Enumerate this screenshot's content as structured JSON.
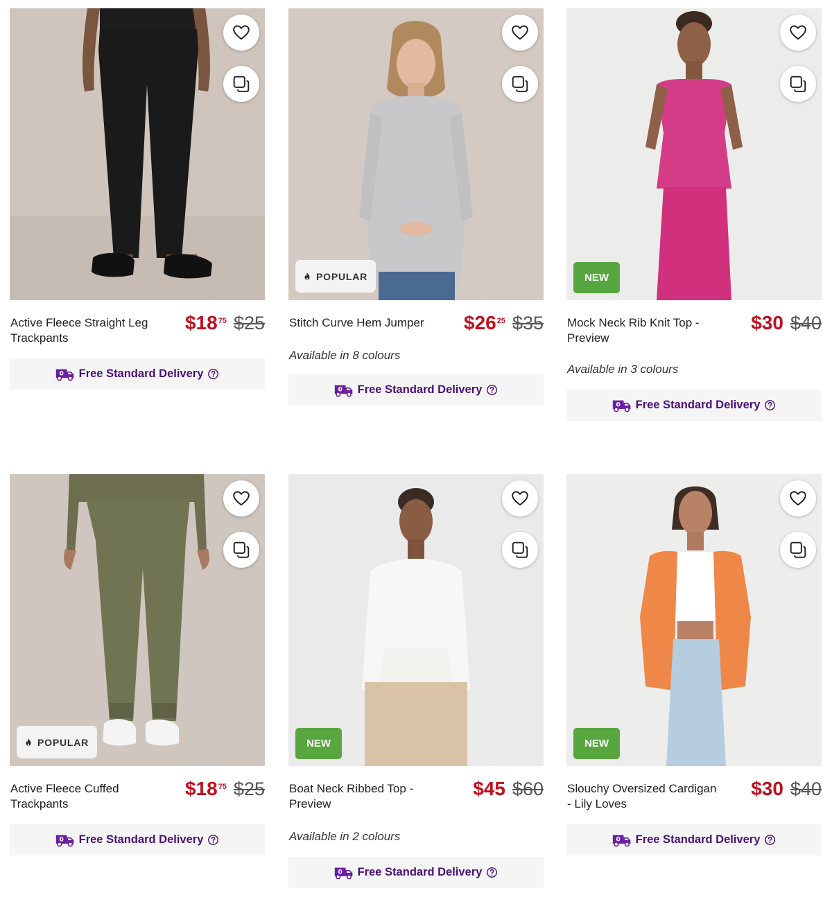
{
  "colors": {
    "accent_price": "#c0101f",
    "delivery_text": "#4b0f78",
    "new_badge": "#57a63f"
  },
  "icons": {
    "favourite": "heart-icon",
    "compare": "compare-icon",
    "popular": "flame-icon",
    "delivery": "delivery-truck-icon",
    "help": "help-circle-icon"
  },
  "products": [
    {
      "name": "Active Fleece Straight Leg Trackpants",
      "price_whole": "$18",
      "price_cents": "75",
      "was_price": "$25",
      "badge": "",
      "colours": "",
      "delivery": "Free Standard Delivery"
    },
    {
      "name": "Stitch Curve Hem Jumper",
      "price_whole": "$26",
      "price_cents": "25",
      "was_price": "$35",
      "badge": "POPULAR",
      "colours": "Available in 8 colours",
      "delivery": "Free Standard Delivery"
    },
    {
      "name": "Mock Neck Rib Knit Top - Preview",
      "price_whole": "$30",
      "price_cents": "",
      "was_price": "$40",
      "badge": "NEW",
      "colours": "Available in 3 colours",
      "delivery": "Free Standard Delivery"
    },
    {
      "name": "Active Fleece Cuffed Trackpants",
      "price_whole": "$18",
      "price_cents": "75",
      "was_price": "$25",
      "badge": "POPULAR",
      "colours": "",
      "delivery": "Free Standard Delivery"
    },
    {
      "name": "Boat Neck Ribbed Top - Preview",
      "price_whole": "$45",
      "price_cents": "",
      "was_price": "$60",
      "badge": "NEW",
      "colours": "Available in 2 colours",
      "delivery": "Free Standard Delivery"
    },
    {
      "name": "Slouchy Oversized Cardigan - Lily Loves",
      "price_whole": "$30",
      "price_cents": "",
      "was_price": "$40",
      "badge": "NEW",
      "colours": "",
      "delivery": "Free Standard Delivery"
    }
  ]
}
